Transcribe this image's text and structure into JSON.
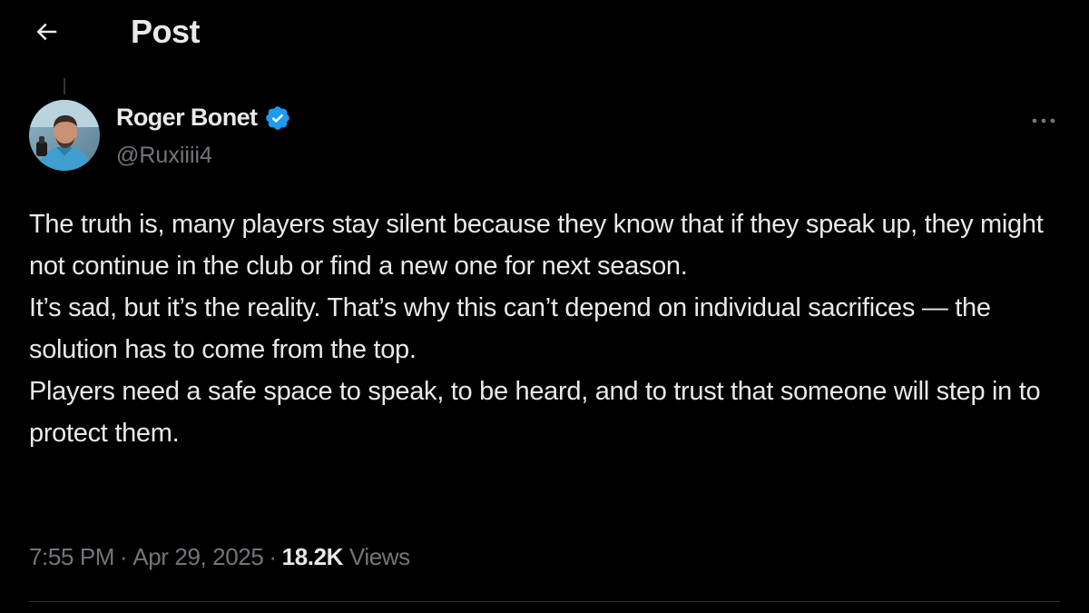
{
  "header": {
    "title": "Post",
    "back_icon": "arrow-left-icon"
  },
  "author": {
    "display_name": "Roger Bonet",
    "handle": "@Ruxiiii4",
    "verified": true,
    "verified_icon": "verified-badge-icon",
    "verified_color": "#1d9bf0"
  },
  "post": {
    "paragraphs": [
      "The truth is, many players stay silent because they know that if they speak up, they might not continue in the club or find a new one for next season.",
      "It’s sad, but it’s the reality. That’s why this can’t depend on individual sacrifices — the solution has to come from the top.",
      "Players need a safe space to speak, to be heard, and to trust that someone will step in to protect them."
    ],
    "time": "7:55 PM",
    "separator": "·",
    "date": "Apr 29, 2025",
    "views_count": "18.2K",
    "views_label": "Views"
  },
  "actions": {
    "more_icon": "more-options-icon"
  },
  "colors": {
    "background": "#000000",
    "text_primary": "#e7e9ea",
    "text_secondary": "#71767b",
    "divider": "#2f3336",
    "accent": "#1d9bf0"
  }
}
